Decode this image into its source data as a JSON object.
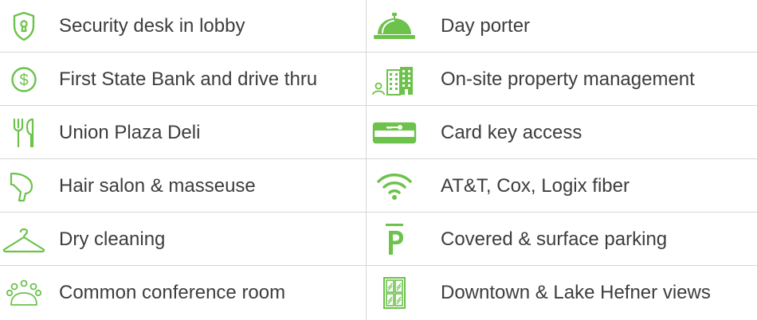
{
  "accent_color": "#6cc24a",
  "amenities": {
    "left": [
      {
        "label": "Security desk in lobby",
        "icon": "shield-keyhole-icon"
      },
      {
        "label": "First State Bank and drive thru",
        "icon": "dollar-circle-icon"
      },
      {
        "label": "Union Plaza Deli",
        "icon": "fork-knife-icon"
      },
      {
        "label": "Hair salon & masseuse",
        "icon": "hair-dryer-icon"
      },
      {
        "label": "Dry cleaning",
        "icon": "hanger-icon"
      },
      {
        "label": "Common conference room",
        "icon": "conference-table-icon"
      }
    ],
    "right": [
      {
        "label": "Day porter",
        "icon": "service-bell-icon"
      },
      {
        "label": "On-site property management",
        "icon": "person-building-icon"
      },
      {
        "label": "Card key access",
        "icon": "key-card-icon"
      },
      {
        "label": "AT&T, Cox, Logix fiber",
        "icon": "wifi-icon"
      },
      {
        "label": "Covered & surface parking",
        "icon": "parking-icon"
      },
      {
        "label": "Downtown & Lake Hefner views",
        "icon": "window-icon"
      }
    ]
  }
}
